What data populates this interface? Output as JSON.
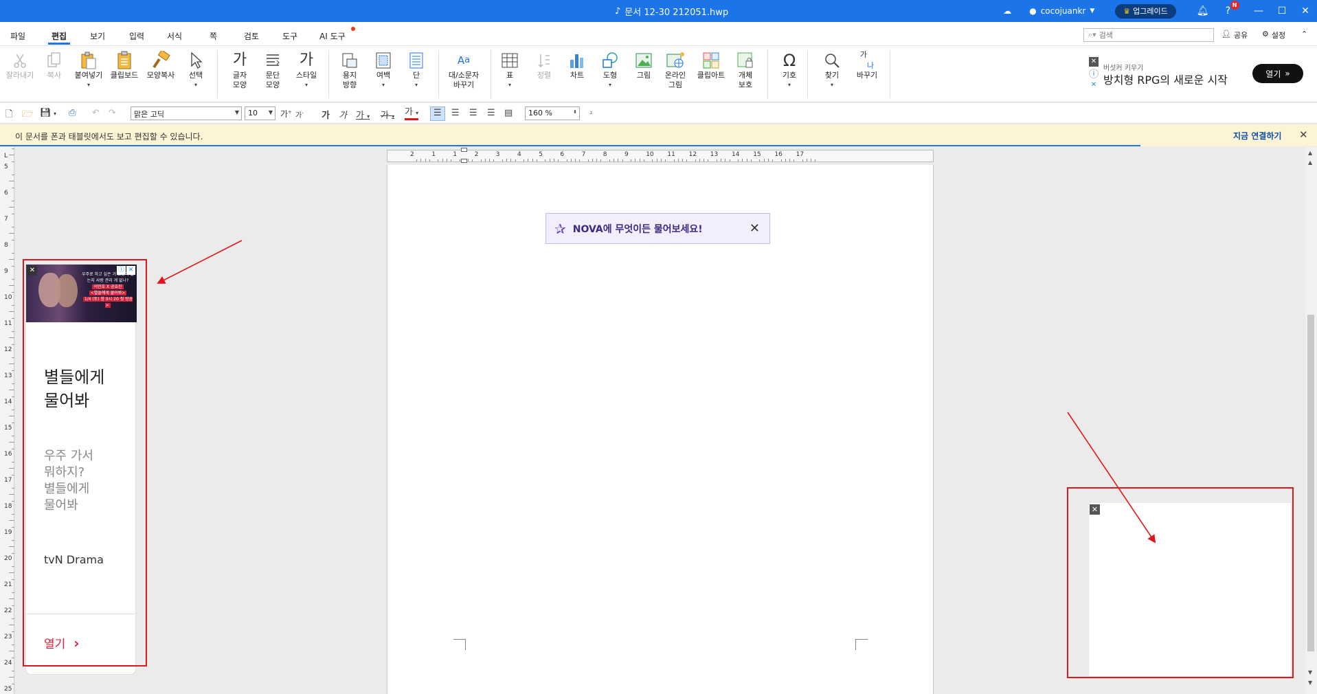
{
  "titlebar": {
    "title": "문서 12-30 212051.hwp",
    "username": "cocojuankr",
    "upgrade_label": "업그레이드",
    "help_badge": "N"
  },
  "menu": {
    "items": [
      "파일",
      "편집",
      "보기",
      "입력",
      "서식",
      "쪽",
      "검토",
      "도구",
      "AI 도구"
    ],
    "active": "편집",
    "search_placeholder": "검색",
    "share_label": "공유",
    "settings_label": "설정"
  },
  "ribbon": {
    "buttons": [
      {
        "label": "잘라내기",
        "icon": "scissors-icon"
      },
      {
        "label": "복사",
        "icon": "copy-icon"
      },
      {
        "label": "붙여넣기",
        "icon": "paste-icon"
      },
      {
        "label": "클립보드",
        "icon": "clipboard-icon"
      },
      {
        "label": "모양복사",
        "icon": "format-painter-icon"
      },
      {
        "label": "선택",
        "icon": "cursor-icon"
      },
      {
        "label": "글자\n모양",
        "icon": "char-shape-icon"
      },
      {
        "label": "문단\n모양",
        "icon": "para-shape-icon"
      },
      {
        "label": "스타일",
        "icon": "style-icon"
      },
      {
        "label": "용지\n방향",
        "icon": "orientation-icon"
      },
      {
        "label": "여백",
        "icon": "margin-icon"
      },
      {
        "label": "단",
        "icon": "columns-icon"
      },
      {
        "label": "대/소문자\n바꾸기",
        "icon": "case-icon"
      },
      {
        "label": "표",
        "icon": "table-icon"
      },
      {
        "label": "정렬",
        "icon": "sort-icon"
      },
      {
        "label": "차트",
        "icon": "chart-icon"
      },
      {
        "label": "도형",
        "icon": "shape-icon"
      },
      {
        "label": "그림",
        "icon": "picture-icon"
      },
      {
        "label": "온라인\n그림",
        "icon": "online-picture-icon"
      },
      {
        "label": "클립아트",
        "icon": "clipart-icon"
      },
      {
        "label": "개체\n보호",
        "icon": "object-protect-icon"
      },
      {
        "label": "기호",
        "icon": "omega-icon"
      },
      {
        "label": "찾기",
        "icon": "find-icon"
      },
      {
        "label": "바꾸기",
        "icon": "replace-icon"
      }
    ],
    "ribbon_glyphs": {
      "char": "가",
      "style": "가",
      "replace_top": "가",
      "replace_bottom": "나",
      "case": "A",
      "case_small": "a",
      "omega": "Ω"
    }
  },
  "top_ad": {
    "small_text": "버섯커 키우기",
    "big_text": "방치형 RPG의 새로운 시작",
    "button": "열기"
  },
  "format": {
    "font": "맑은 고딕",
    "size": "10",
    "zoom": "160 %",
    "bold": "가",
    "italic": "가",
    "underline": "가",
    "strike": "가",
    "color": "가",
    "grow": "가",
    "shrink": "가"
  },
  "notification": {
    "text": "이 문서를 폰과 태블릿에서도 보고 편집할 수 있습니다.",
    "link": "지금 연결하기"
  },
  "ruler": {
    "vertical": [
      "5",
      "6",
      "7",
      "8",
      "9",
      "10",
      "11",
      "12",
      "13",
      "14",
      "15",
      "16",
      "17",
      "18",
      "19",
      "20",
      "21",
      "22",
      "23",
      "24",
      "25"
    ],
    "horizontal": [
      "2",
      "1",
      "1",
      "2",
      "3",
      "4",
      "5",
      "6",
      "7",
      "8",
      "9",
      "10",
      "11",
      "12",
      "13",
      "14",
      "15",
      "16",
      "17"
    ],
    "corner": "L"
  },
  "nova": {
    "text": "NOVA에 무엇이든 물어보세요!"
  },
  "left_ad": {
    "photo_line1": "우주로 하고 싶은 거 로봇이 있는지 사랑 관리 게 없나?",
    "photo_line2": "이민호 X 공효진",
    "photo_line3": "<별들에게 물어봐>",
    "photo_line4": "1/4 (토) 밤 9시 20 첫 방송 >",
    "headline": [
      "별들에게",
      "물어봐"
    ],
    "sub": [
      "우주 가서",
      "뭐하지?",
      "별들에게",
      "물어봐"
    ],
    "brand": "tvN Drama",
    "open": "열기"
  },
  "colors": {
    "accent": "#1b75e8",
    "annotation": "#e0161f",
    "ad_red": "#e01e3c"
  }
}
